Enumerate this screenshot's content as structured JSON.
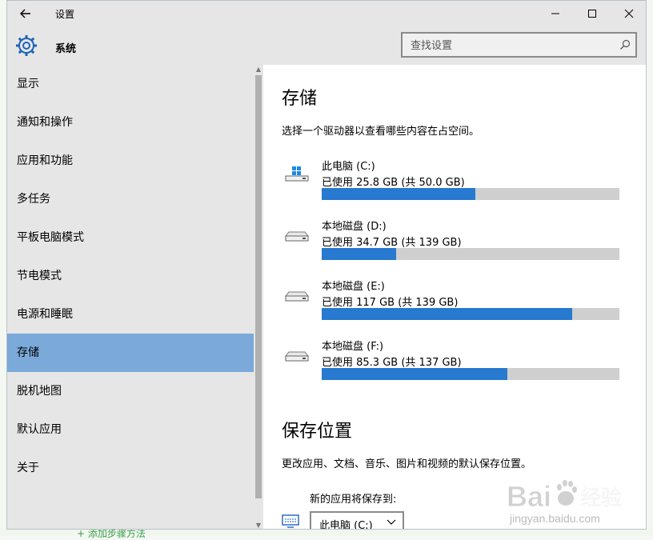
{
  "window": {
    "title": "设置",
    "header_title": "系统",
    "search_placeholder": "查找设置"
  },
  "sidebar": {
    "items": [
      {
        "label": "显示",
        "active": false
      },
      {
        "label": "通知和操作",
        "active": false
      },
      {
        "label": "应用和功能",
        "active": false
      },
      {
        "label": "多任务",
        "active": false
      },
      {
        "label": "平板电脑模式",
        "active": false
      },
      {
        "label": "节电模式",
        "active": false
      },
      {
        "label": "电源和睡眠",
        "active": false
      },
      {
        "label": "存储",
        "active": true
      },
      {
        "label": "脱机地图",
        "active": false
      },
      {
        "label": "默认应用",
        "active": false
      },
      {
        "label": "关于",
        "active": false
      }
    ]
  },
  "storage": {
    "heading": "存储",
    "description": "选择一个驱动器以查看哪些内容在占空间。",
    "drives": [
      {
        "name": "此电脑 (C:)",
        "usage": "已使用 25.8 GB (共 50.0 GB)",
        "used_fraction": 0.516,
        "icon": "windows-drive-icon"
      },
      {
        "name": "本地磁盘 (D:)",
        "usage": "已使用 34.7 GB (共 139 GB)",
        "used_fraction": 0.25,
        "icon": "drive-icon"
      },
      {
        "name": "本地磁盘 (E:)",
        "usage": "已使用 117 GB (共 139 GB)",
        "used_fraction": 0.842,
        "icon": "drive-icon"
      },
      {
        "name": "本地磁盘 (F:)",
        "usage": "已使用 85.3 GB (共 137 GB)",
        "used_fraction": 0.623,
        "icon": "drive-icon"
      }
    ]
  },
  "save_locations": {
    "heading": "保存位置",
    "description": "更改应用、文档、音乐、图片和视频的默认保存位置。",
    "new_apps_label": "新的应用将保存到:",
    "new_apps_value": "此电脑 (C:)"
  },
  "background": {
    "bottom_text": "+ 添加步骤方法"
  },
  "watermark": {
    "brand": "Bai",
    "brand_cn": "经验",
    "url": "jingyan.baidu.com"
  },
  "colors": {
    "accent": "#2879d0",
    "selected_nav": "#7ba9d9",
    "chrome": "#e6e6e6",
    "bar_track": "#cfcfcf",
    "settings_icon": "#1e63b8"
  }
}
